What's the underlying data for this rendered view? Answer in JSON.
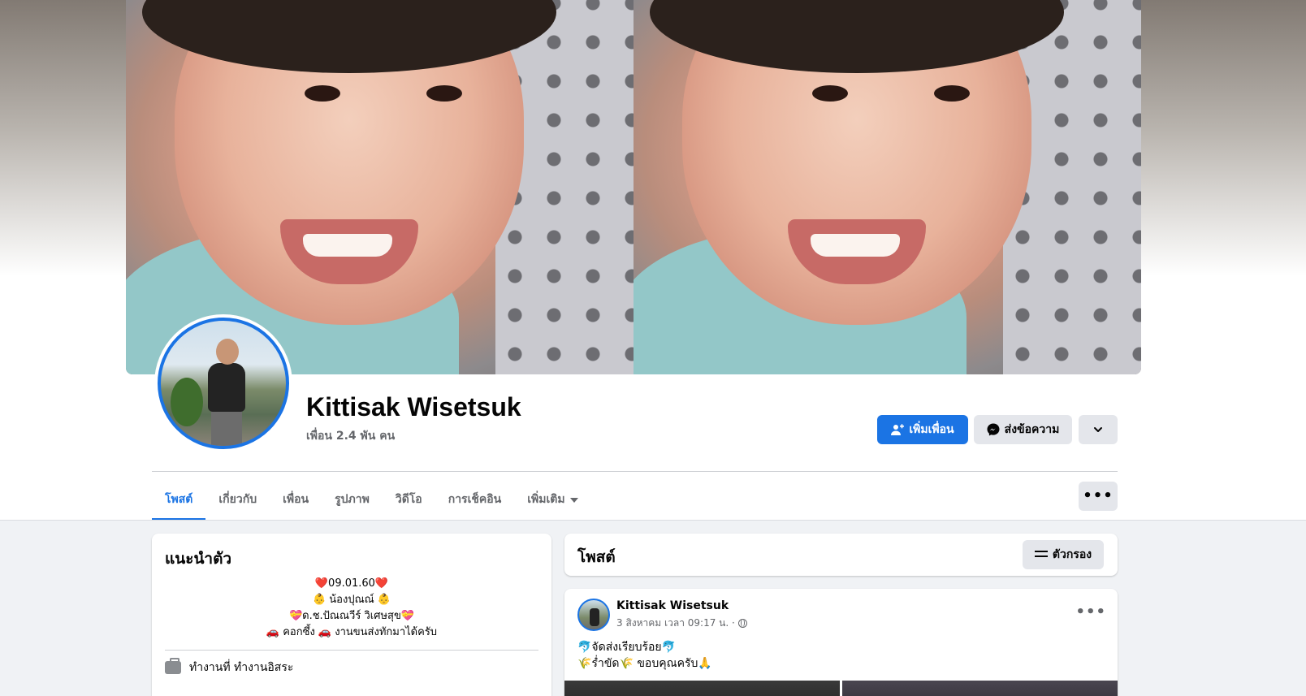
{
  "profile": {
    "name": "Kittisak Wisetsuk",
    "friends": "เพื่อน 2.4 พัน คน"
  },
  "actions": {
    "add_friend": "เพิ่มเพื่อน",
    "message": "ส่งข้อความ"
  },
  "tabs": [
    {
      "label": "โพสต์",
      "active": true
    },
    {
      "label": "เกี่ยวกับ",
      "active": false
    },
    {
      "label": "เพื่อน",
      "active": false
    },
    {
      "label": "รูปภาพ",
      "active": false
    },
    {
      "label": "วิดีโอ",
      "active": false
    },
    {
      "label": "การเช็คอิน",
      "active": false
    },
    {
      "label": "เพิ่มเติม",
      "active": false
    }
  ],
  "intro": {
    "title": "แนะนำตัว",
    "bio": [
      "❤️09.01.60❤️",
      "👶 น้องปุณณ์ 👶",
      "💝ด.ช.ปัณณวีร์ วิเศษสุข💝",
      "🚗 คอกซึ้ง 🚗  งานขนส่งทักมาได้ครับ"
    ],
    "work": "ทำงานที่ ทำงานอิสระ"
  },
  "posts_section": {
    "title": "โพสต์",
    "filter_label": "ตัวกรอง"
  },
  "post": {
    "author": "Kittisak Wisetsuk",
    "meta": "3 สิงหาคม เวลา 09:17 น. ·",
    "text": [
      "🐬จัดส่งเรียบร้อย🐬",
      "🌾ร่ำขัด🌾  ขอบคุณครับ🙏"
    ]
  },
  "colors": {
    "accent": "#1b74e4",
    "background": "#f0f2f5",
    "secondary_button": "#e4e6eb"
  },
  "icons": {
    "add_friend": "person-plus-icon",
    "message": "messenger-icon",
    "more": "chevron-down-icon",
    "tab_more": "caret-down-icon",
    "options": "ellipsis-icon",
    "filter": "sliders-icon",
    "work": "briefcase-icon",
    "privacy": "globe-icon"
  }
}
